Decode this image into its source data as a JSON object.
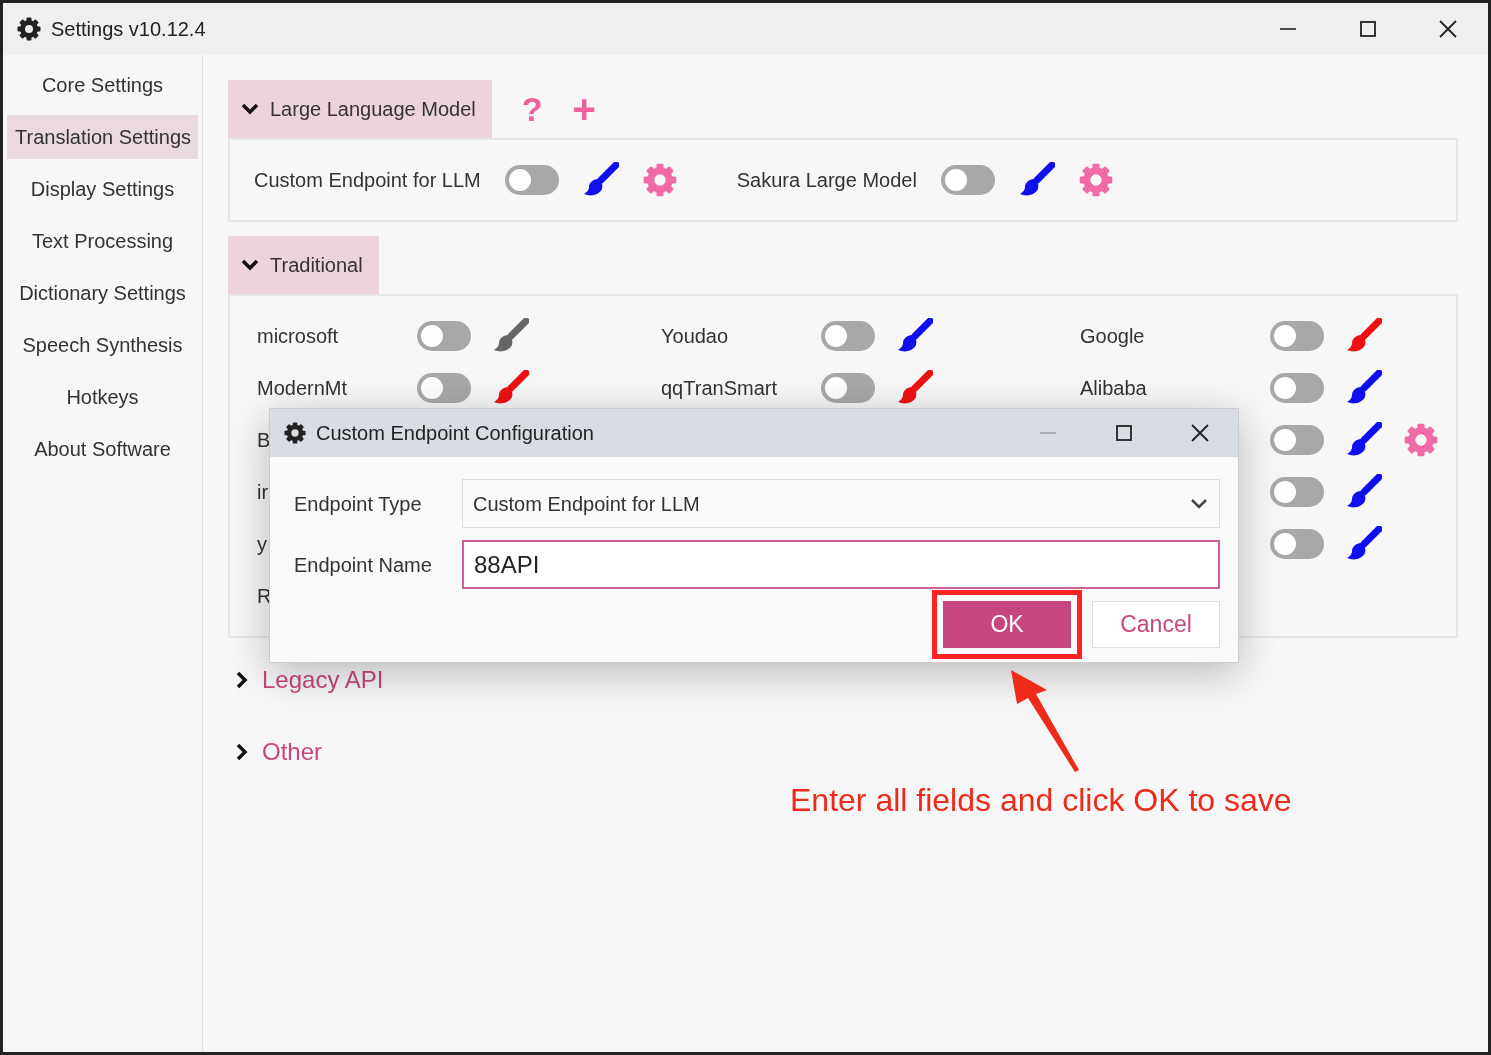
{
  "window": {
    "title": "Settings v10.12.4"
  },
  "sidebar": {
    "items": [
      {
        "label": "Core Settings",
        "selected": false
      },
      {
        "label": "Translation Settings",
        "selected": true
      },
      {
        "label": "Display Settings",
        "selected": false
      },
      {
        "label": "Text Processing",
        "selected": false
      },
      {
        "label": "Dictionary Settings",
        "selected": false
      },
      {
        "label": "Speech Synthesis",
        "selected": false
      },
      {
        "label": "Hotkeys",
        "selected": false
      },
      {
        "label": "About Software",
        "selected": false
      }
    ]
  },
  "llm_section": {
    "title": "Large Language Model",
    "expanded": true,
    "help": "?",
    "add": "+",
    "items": [
      {
        "name": "Custom Endpoint for LLM",
        "on": false,
        "color": "#1010ee",
        "settings": true
      },
      {
        "name": "Sakura Large Model",
        "on": false,
        "color": "#1010ee",
        "settings": true
      }
    ]
  },
  "traditional_section": {
    "title": "Traditional",
    "expanded": true,
    "rows": [
      {
        "left": {
          "name": "microsoft",
          "on": false,
          "color": "#666666"
        },
        "middle": {
          "name": "Youdao",
          "on": false,
          "color": "#1010ee"
        },
        "right": {
          "name": "Google",
          "on": false,
          "color": "#ee1111"
        }
      },
      {
        "left": {
          "name": "ModernMt",
          "on": false,
          "color": "#ee1111"
        },
        "middle": {
          "name": "qqTranSmart",
          "on": false,
          "color": "#ee1111"
        },
        "right": {
          "name": "Alibaba",
          "on": false,
          "color": "#1010ee"
        }
      },
      {
        "left": {
          "name": "B"
        },
        "right": {
          "on": false,
          "color": "#1010ee",
          "settings": true
        }
      },
      {
        "left": {
          "name": "ir"
        },
        "right": {
          "on": false,
          "color": "#1010ee"
        }
      },
      {
        "left": {
          "name": "y"
        },
        "right": {
          "on": false,
          "color": "#1010ee"
        }
      },
      {
        "left": {
          "name": "R"
        }
      }
    ]
  },
  "collapsed_sections": [
    {
      "title": "Legacy API",
      "expanded": false
    },
    {
      "title": "Other",
      "expanded": false
    }
  ],
  "dialog": {
    "title": "Custom Endpoint Configuration",
    "fields": [
      {
        "kind": "select",
        "label": "Endpoint Type",
        "value": "Custom Endpoint for LLM"
      },
      {
        "kind": "text",
        "label": "Endpoint Name",
        "value": "88API",
        "focused": true
      }
    ],
    "buttons": [
      {
        "label": "OK",
        "primary": true,
        "highlighted": true
      },
      {
        "label": "Cancel",
        "primary": false
      }
    ]
  },
  "annotation": {
    "text": "Enter all fields and click OK to save"
  }
}
